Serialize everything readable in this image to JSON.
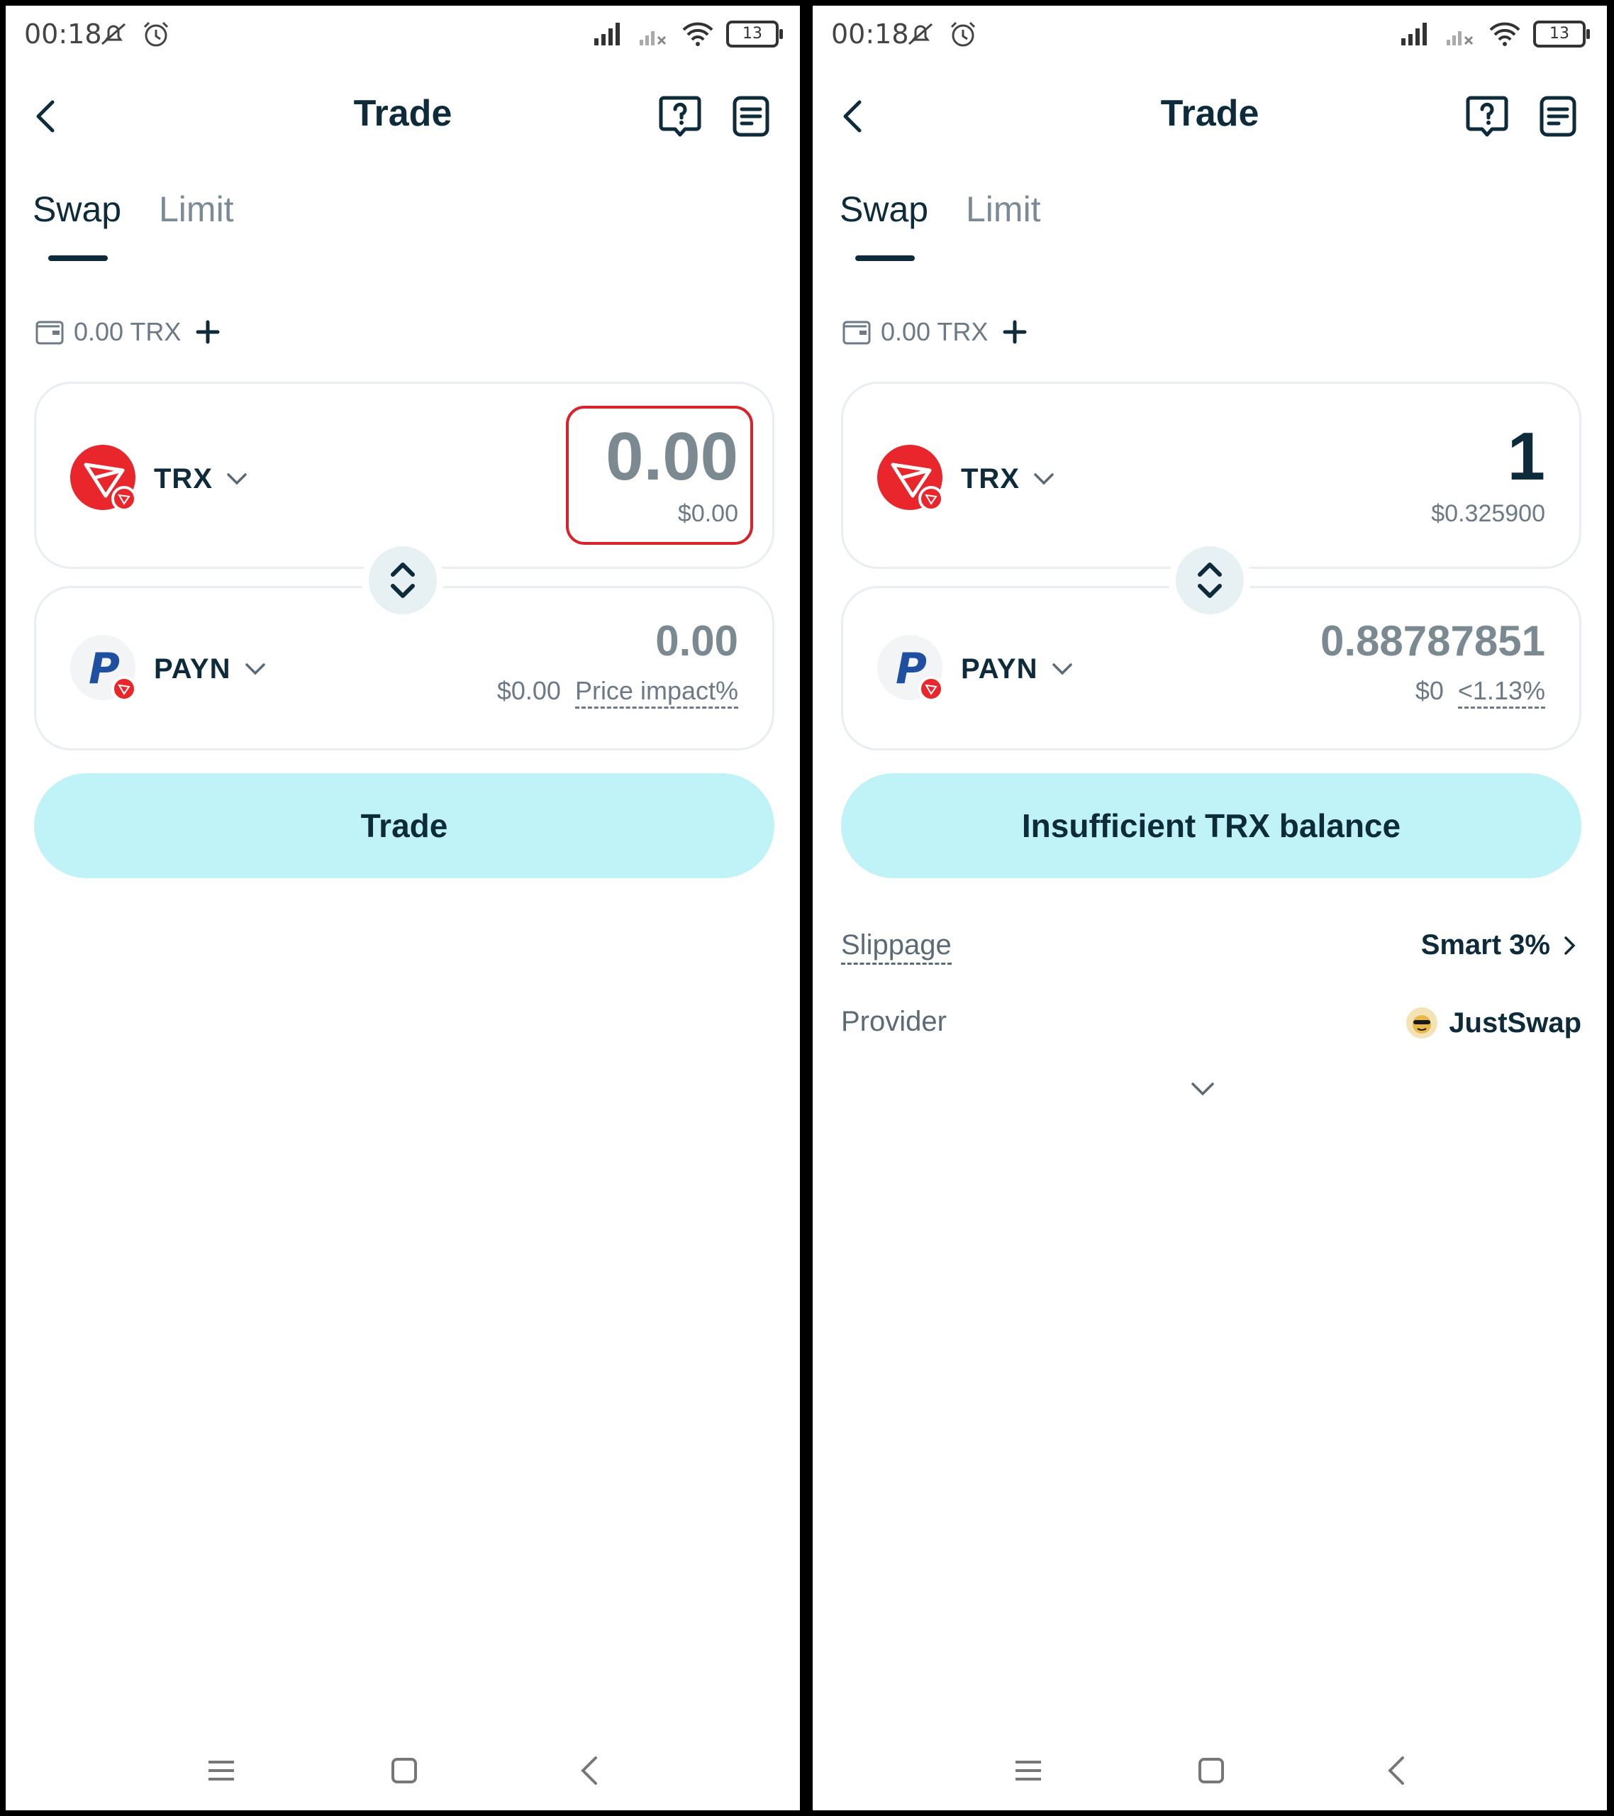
{
  "status": {
    "time": "00:18",
    "battery": "13"
  },
  "header": {
    "title": "Trade"
  },
  "tabs": {
    "swap": "Swap",
    "limit": "Limit"
  },
  "balance": {
    "text": "0.00 TRX"
  },
  "colors": {
    "accent": "#bff3f7",
    "primary_text": "#0d2b3a",
    "trx_red": "#e8262b",
    "highlight": "#d8232a",
    "payn_blue": "#1f4fa0"
  },
  "left": {
    "from": {
      "token": "TRX",
      "amount": "0.00",
      "usd": "$0.00"
    },
    "to": {
      "token": "PAYN",
      "amount": "0.00",
      "usd": "$0.00",
      "impact": "Price impact%"
    },
    "button": "Trade"
  },
  "right": {
    "from": {
      "token": "TRX",
      "amount": "1",
      "usd": "$0.325900"
    },
    "to": {
      "token": "PAYN",
      "amount": "0.88787851",
      "usd": "$0",
      "impact": "<1.13%"
    },
    "button": "Insufficient TRX balance",
    "slippage": {
      "label": "Slippage",
      "value": "Smart 3%"
    },
    "provider": {
      "label": "Provider",
      "value": "JustSwap"
    }
  },
  "icons": {
    "back": "back-arrow-icon",
    "help": "help-question-icon",
    "history": "history-list-icon",
    "wallet": "wallet-icon",
    "plus": "plus-icon",
    "switch": "swap-direction-icon",
    "chevron": "chevron-down-icon",
    "nav_menu": "menu-icon",
    "nav_home": "home-icon",
    "nav_back": "nav-back-icon"
  }
}
